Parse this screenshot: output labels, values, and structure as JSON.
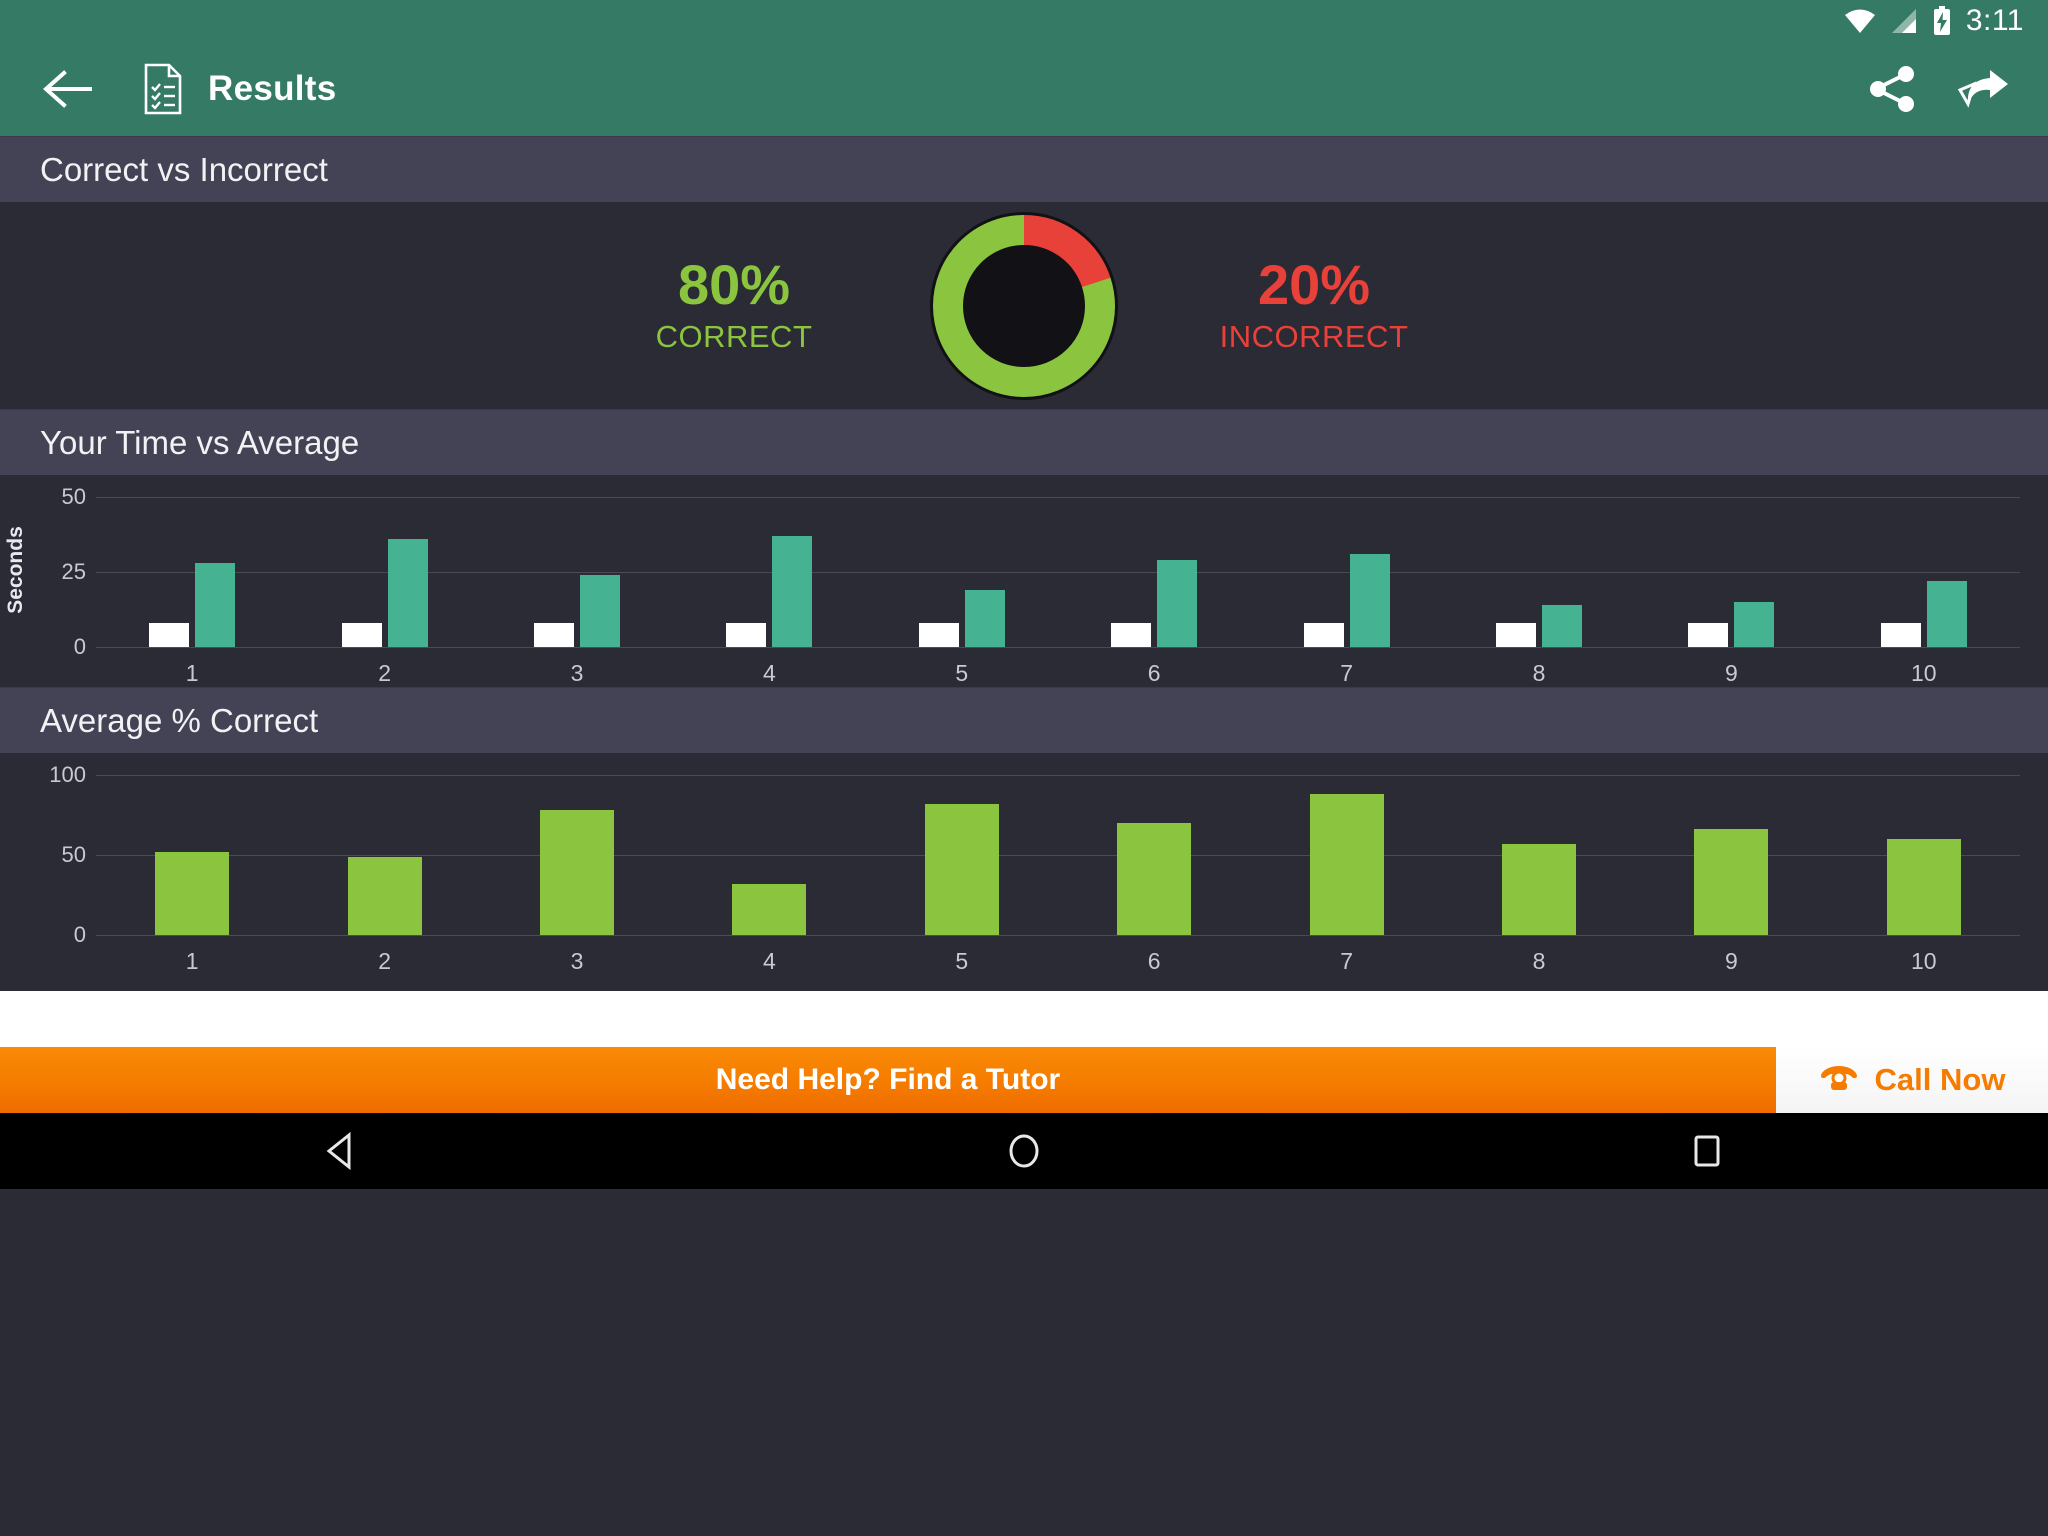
{
  "statusbar": {
    "time": "3:11",
    "icons": [
      "wifi-icon",
      "cellular-signal-icon",
      "battery-charging-icon"
    ]
  },
  "appbar": {
    "back_icon": "back-arrow-icon",
    "doc_icon": "quiz-document-icon",
    "title": "Results",
    "share_icon": "share-icon",
    "navigate_icon": "navigate-arrow-icon"
  },
  "sections": {
    "correct_vs_incorrect": {
      "header": "Correct vs Incorrect",
      "correct_pct": "80%",
      "correct_label": "CORRECT",
      "incorrect_pct": "20%",
      "incorrect_label": "INCORRECT"
    },
    "time_vs_average": {
      "header": "Your Time vs Average"
    },
    "average_correct": {
      "header": "Average % Correct"
    }
  },
  "banner": {
    "message": "Need Help? Find a Tutor",
    "call_label": "Call Now",
    "phone_icon": "telephone-icon",
    "accent": "#f57c00"
  },
  "navbar": {
    "back": "nav-back-icon",
    "home": "nav-home-icon",
    "recents": "nav-recents-icon"
  },
  "colors": {
    "brand_green": "#357a64",
    "correct_green": "#8bc53f",
    "incorrect_red": "#e8413a",
    "avg_teal": "#45b392",
    "your_time_white": "#ffffff",
    "panel_bg": "#2b2b35",
    "header_bg": "#434355"
  },
  "chart_data": [
    {
      "type": "pie",
      "title": "Correct vs Incorrect",
      "labels": [
        "CORRECT",
        "INCORRECT"
      ],
      "values": [
        80,
        20
      ],
      "colors": [
        "#8bc53f",
        "#e8413a"
      ],
      "donut": true,
      "start_angle_deg": 0,
      "legend": "sides"
    },
    {
      "type": "bar",
      "title": "Your Time vs Average",
      "xlabel": "",
      "ylabel": "Seconds",
      "categories": [
        "1",
        "2",
        "3",
        "4",
        "5",
        "6",
        "7",
        "8",
        "9",
        "10"
      ],
      "ylim": [
        0,
        50
      ],
      "yticks": [
        0,
        25,
        50
      ],
      "grid": true,
      "legend": "none",
      "series": [
        {
          "name": "Your Time",
          "color": "#ffffff",
          "values": [
            8,
            8,
            8,
            8,
            8,
            8,
            8,
            8,
            8,
            8
          ]
        },
        {
          "name": "Average",
          "color": "#45b392",
          "values": [
            28,
            36,
            24,
            37,
            19,
            29,
            31,
            14,
            15,
            22
          ]
        }
      ]
    },
    {
      "type": "bar",
      "title": "Average % Correct",
      "xlabel": "",
      "ylabel": "",
      "categories": [
        "1",
        "2",
        "3",
        "4",
        "5",
        "6",
        "7",
        "8",
        "9",
        "10"
      ],
      "ylim": [
        0,
        100
      ],
      "yticks": [
        0,
        50,
        100
      ],
      "grid": true,
      "legend": "none",
      "series": [
        {
          "name": "Average % Correct",
          "color": "#8bc53f",
          "values": [
            52,
            49,
            78,
            32,
            82,
            70,
            88,
            57,
            66,
            60
          ]
        }
      ]
    }
  ]
}
